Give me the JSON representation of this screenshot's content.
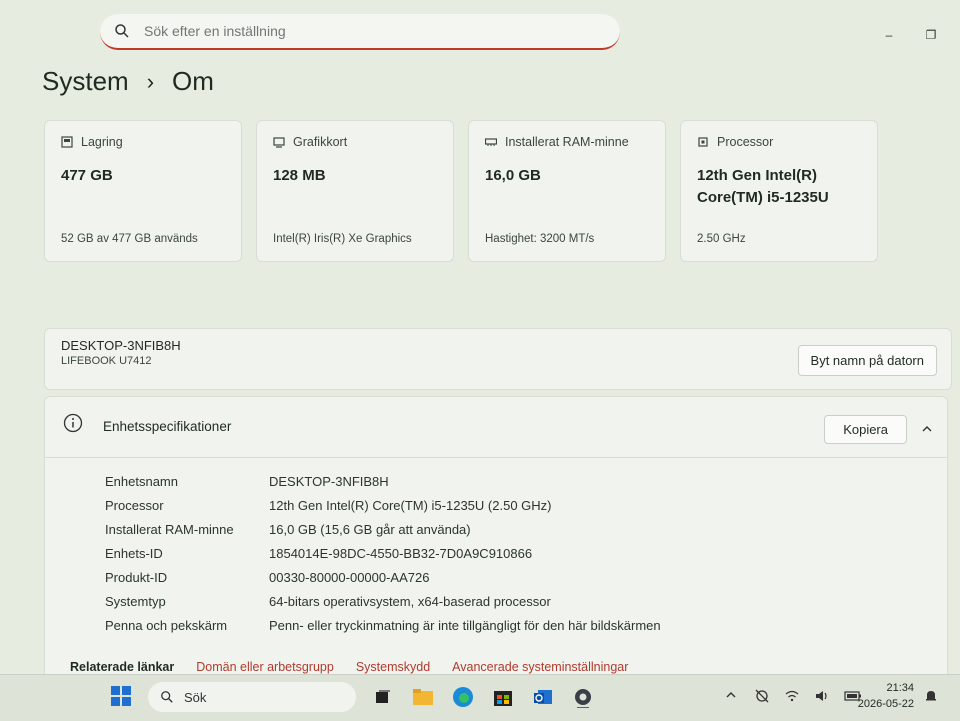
{
  "search": {
    "placeholder": "Sök efter en inställning"
  },
  "window_controls": {
    "minimize": "–",
    "restore": "❐"
  },
  "breadcrumb": {
    "parent": "System",
    "separator": "›",
    "current": "Om"
  },
  "cards": [
    {
      "title": "Lagring",
      "value": "477 GB",
      "sub": "52 GB av 477 GB används",
      "icon": "storage-icon"
    },
    {
      "title": "Grafikkort",
      "value": "128 MB",
      "sub": "Intel(R) Iris(R) Xe Graphics",
      "icon": "gpu-icon"
    },
    {
      "title": "Installerat RAM-minne",
      "value": "16,0 GB",
      "sub": "Hastighet: 3200 MT/s",
      "icon": "ram-icon"
    },
    {
      "title": "Processor",
      "value": "12th Gen Intel(R) Core(TM) i5-1235U",
      "sub": "2.50 GHz",
      "icon": "cpu-icon"
    }
  ],
  "device": {
    "name": "DESKTOP-3NFIB8H",
    "model": "LIFEBOOK U7412",
    "rename_label": "Byt namn på datorn"
  },
  "specs": {
    "title": "Enhetsspecifikationer",
    "copy_label": "Kopiera",
    "rows": [
      {
        "label": "Enhetsnamn",
        "value": "DESKTOP-3NFIB8H"
      },
      {
        "label": "Processor",
        "value": "12th Gen Intel(R) Core(TM) i5-1235U (2.50 GHz)"
      },
      {
        "label": "Installerat RAM-minne",
        "value": "16,0 GB (15,6 GB går att använda)"
      },
      {
        "label": "Enhets-ID",
        "value": "1854014E-98DC-4550-BB32-7D0A9C910866"
      },
      {
        "label": "Produkt-ID",
        "value": "00330-80000-00000-AA726"
      },
      {
        "label": "Systemtyp",
        "value": "64-bitars operativsystem, x64-baserad processor"
      },
      {
        "label": "Penna och pekskärm",
        "value": "Penn- eller tryckinmatning är inte tillgängligt för den här bildskärmen"
      }
    ]
  },
  "related": {
    "title": "Relaterade länkar",
    "links": [
      "Domän eller arbetsgrupp",
      "Systemskydd",
      "Avancerade systeminställningar"
    ]
  },
  "taskbar": {
    "search_label": "Sök",
    "time": "21:34",
    "date": "2026-05-22"
  },
  "colors": {
    "accent": "#c0392b",
    "background": "#e6ecdf",
    "card": "#f1f4ee"
  }
}
